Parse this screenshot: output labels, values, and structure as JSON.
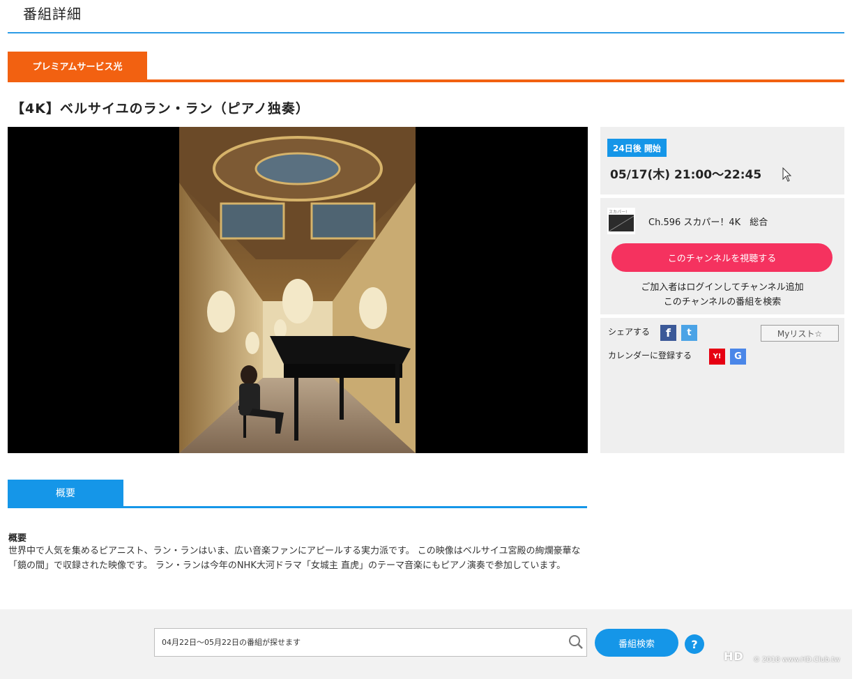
{
  "header": {
    "title": "番組詳細"
  },
  "service": {
    "label": "プレミアムサービス光"
  },
  "program": {
    "title": "【4K】ベルサイユのラン・ラン（ピアノ独奏）",
    "start_badge": "24日後 開始",
    "datetime": "05/17(木) 21:00〜22:45"
  },
  "channel": {
    "logo_text": "スカパー!",
    "name": "Ch.596 スカパー！4K　総合",
    "watch_button": "このチャンネルを視聴する",
    "login_link": "ご加入者はログインしてチャンネル追加",
    "search_link": "このチャンネルの番組を検索"
  },
  "share": {
    "label": "シェアする",
    "calendar_label": "カレンダーに登録する",
    "mylist": "Myリスト☆",
    "facebook_glyph": "f",
    "twitter_glyph": "t",
    "yahoo_glyph": "Y!",
    "google_glyph": "G"
  },
  "overview": {
    "tab": "概要",
    "heading": "概要",
    "body": "世界中で人気を集めるピアニスト、ラン・ランはいま、広い音楽ファンにアピールする実力派です。 この映像はベルサイユ宮殿の絢爛豪華な「鏡の間」で収録された映像です。 ラン・ランは今年のNHK大河ドラマ「女城主 直虎」のテーマ音楽にもピアノ演奏で参加しています。"
  },
  "footer": {
    "search_placeholder": "04月22日〜05月22日の番組が探せます",
    "search_button": "番組検索",
    "help": "?"
  },
  "watermark": {
    "logo": "HD",
    "text": "© 2018 www.HD.Club.tw"
  },
  "colors": {
    "accent_blue": "#1596e8",
    "service_orange": "#f26111",
    "watch_pink": "#f5325f"
  }
}
